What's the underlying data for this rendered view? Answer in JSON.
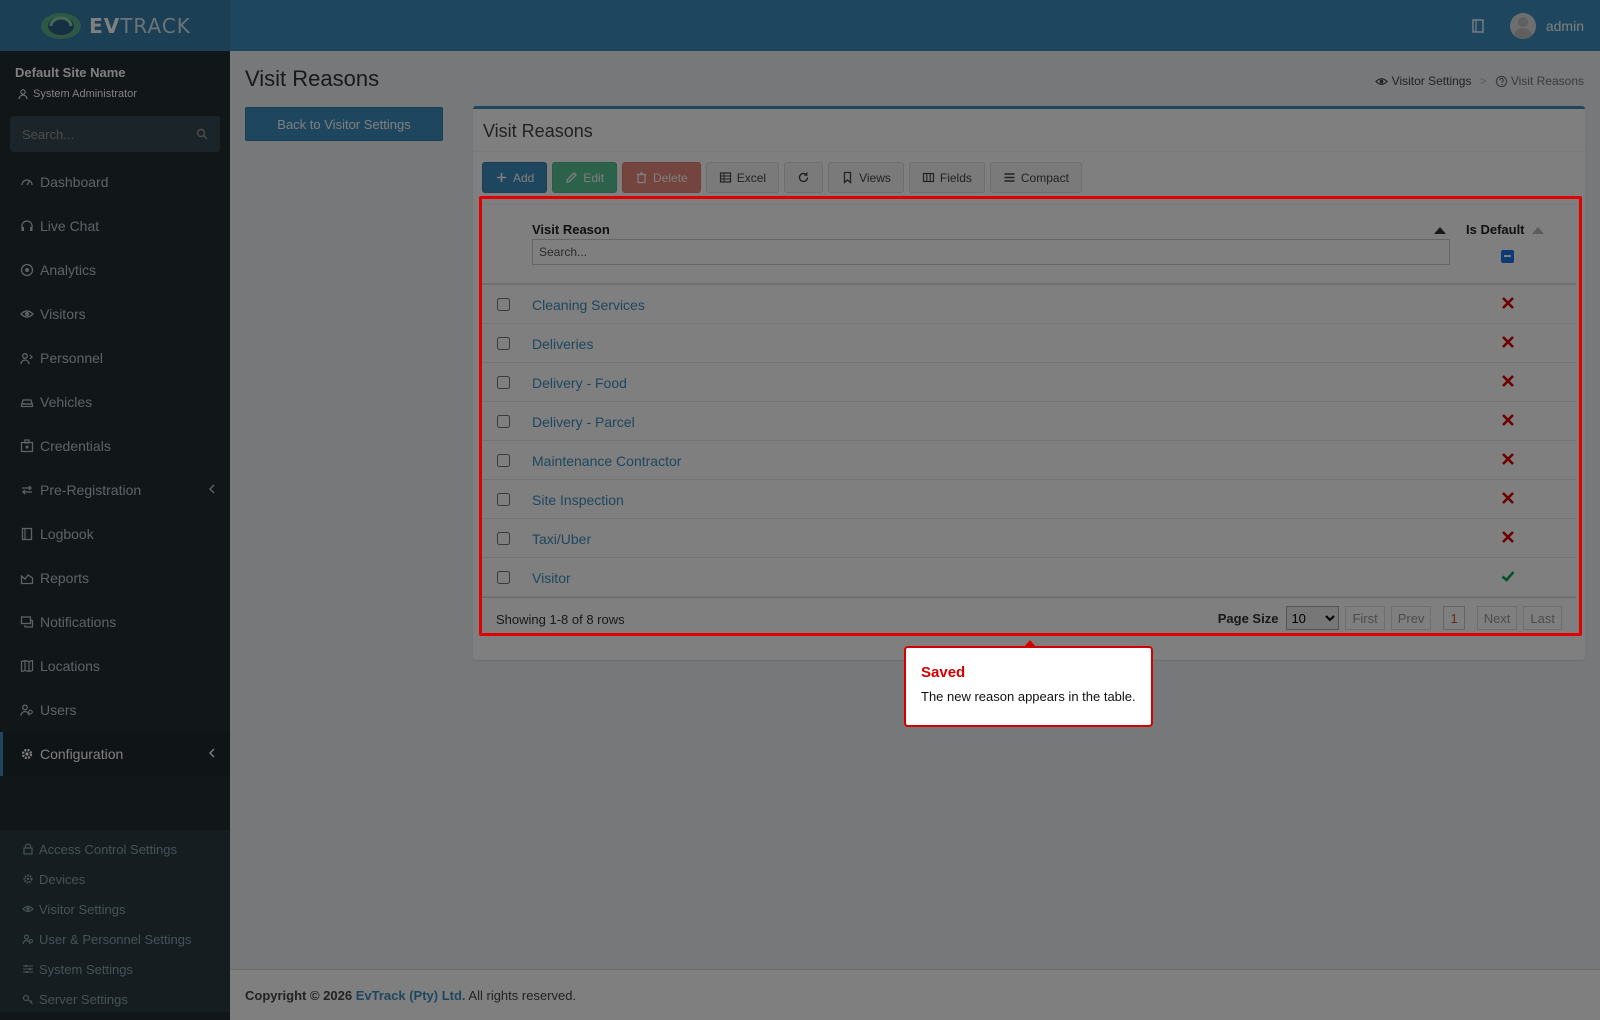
{
  "app": {
    "brand_bold": "EV",
    "brand_rest": "TRACK",
    "user": "admin"
  },
  "sidebar": {
    "site_name": "Default Site Name",
    "role": "System Administrator",
    "search_placeholder": "Search...",
    "items": [
      {
        "label": "Dashboard",
        "icon": "dashboard-icon"
      },
      {
        "label": "Live Chat",
        "icon": "headset-icon"
      },
      {
        "label": "Analytics",
        "icon": "target-icon"
      },
      {
        "label": "Visitors",
        "icon": "eye-icon"
      },
      {
        "label": "Personnel",
        "icon": "user-group-icon"
      },
      {
        "label": "Vehicles",
        "icon": "car-icon"
      },
      {
        "label": "Credentials",
        "icon": "id-card-icon"
      },
      {
        "label": "Pre-Registration",
        "icon": "swap-icon"
      },
      {
        "label": "Logbook",
        "icon": "book-icon"
      },
      {
        "label": "Reports",
        "icon": "chart-icon"
      },
      {
        "label": "Notifications",
        "icon": "chat-icon"
      },
      {
        "label": "Locations",
        "icon": "map-icon"
      },
      {
        "label": "Users",
        "icon": "users-icon"
      },
      {
        "label": "Configuration",
        "icon": "gear-icon"
      }
    ],
    "submenu": [
      {
        "label": "Access Control Settings",
        "icon": "lock-icon"
      },
      {
        "label": "Devices",
        "icon": "cog-icon"
      },
      {
        "label": "Visitor Settings",
        "icon": "eye-icon"
      },
      {
        "label": "User & Personnel Settings",
        "icon": "users-icon"
      },
      {
        "label": "System Settings",
        "icon": "sliders-icon"
      },
      {
        "label": "Server Settings",
        "icon": "key-icon"
      }
    ]
  },
  "page": {
    "title": "Visit Reasons",
    "breadcrumb": {
      "parent": "Visitor Settings",
      "current": "Visit Reasons",
      "separator": ">"
    },
    "back_label": "Back to Visitor Settings",
    "box_title": "Visit Reasons"
  },
  "toolbar": {
    "add": "Add",
    "edit": "Edit",
    "delete": "Delete",
    "excel": "Excel",
    "views": "Views",
    "fields": "Fields",
    "compact": "Compact"
  },
  "grid": {
    "col_reason": "Visit Reason",
    "col_default": "Is Default",
    "search_placeholder": "Search...",
    "rows": [
      {
        "reason": "Cleaning Services",
        "is_default": false
      },
      {
        "reason": "Deliveries",
        "is_default": false
      },
      {
        "reason": "Delivery - Food",
        "is_default": false
      },
      {
        "reason": "Delivery - Parcel",
        "is_default": false
      },
      {
        "reason": "Maintenance Contractor",
        "is_default": false
      },
      {
        "reason": "Site Inspection",
        "is_default": false
      },
      {
        "reason": "Taxi/Uber",
        "is_default": false
      },
      {
        "reason": "Visitor",
        "is_default": true
      }
    ],
    "rows_info": "Showing 1-8 of 8 rows",
    "page_size_label": "Page Size",
    "page_size": "10",
    "pager": {
      "first": "First",
      "prev": "Prev",
      "current": "1",
      "next": "Next",
      "last": "Last"
    }
  },
  "tooltip": {
    "title": "Saved",
    "body": "The new reason appears in the table."
  },
  "footer": {
    "prefix": "Copyright © 2026 ",
    "company": "EvTrack (Pty) Ltd.",
    "suffix": " All rights reserved."
  },
  "colors": {
    "accent": "#3c8dbc",
    "sidebar": "#222d32",
    "highlight": "#e00000",
    "check": "#00a65a",
    "cross": "#dd0000"
  }
}
